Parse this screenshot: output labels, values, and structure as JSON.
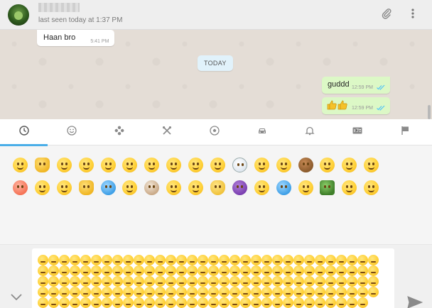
{
  "header": {
    "last_seen": "last seen today at 1:37 PM",
    "icons": [
      "paperclip-icon",
      "more-vertical-icon"
    ]
  },
  "messages": [
    {
      "direction": "incoming",
      "text": "Haan bro",
      "time": "5:41 PM"
    },
    {
      "type": "date-divider",
      "text": "TODAY"
    },
    {
      "direction": "outgoing",
      "text": "guddd",
      "time": "12:59 PM",
      "status": "read"
    },
    {
      "direction": "outgoing",
      "text": "👍👍",
      "time": "12:59 PM",
      "status": "read"
    }
  ],
  "emoji_tabs": [
    {
      "name": "recent",
      "icon": "clock-icon",
      "active": true
    },
    {
      "name": "smileys",
      "icon": "smiley-icon"
    },
    {
      "name": "nature",
      "icon": "flower-icon"
    },
    {
      "name": "food",
      "icon": "fork-knife-icon"
    },
    {
      "name": "activity",
      "icon": "soccer-ball-icon"
    },
    {
      "name": "travel",
      "icon": "car-icon"
    },
    {
      "name": "objects",
      "icon": "bell-icon"
    },
    {
      "name": "symbols",
      "icon": "symbols-icon"
    },
    {
      "name": "flags",
      "icon": "flag-icon"
    }
  ],
  "emoji_grid": {
    "row1": [
      "joy",
      "thumbs-up",
      "smirk",
      "grin",
      "blush",
      "grinning",
      "sweat",
      "unamused",
      "cry",
      "grimacing",
      "snowman",
      "heart-eyes",
      "smile",
      "see-no-evil-monkey",
      "disappointed-relieved",
      "flushed",
      "sweat-smile"
    ],
    "row2": [
      "no-bell",
      "sleeping",
      "stuck-out-tongue",
      "raised-hand",
      "scream",
      "triumph",
      "dog",
      "confounded",
      "mask",
      "cat",
      "imp",
      "relieved",
      "sweat-drops",
      "sleepy",
      "bamboo",
      "dizzy-face",
      "anguished"
    ]
  },
  "composer": {
    "typed_emoji": "unamused",
    "typed_count": 159
  },
  "colors": {
    "header_bg": "#eeeeee",
    "chat_bg": "#e4ddd6",
    "outgoing_bubble": "#dcf8c6",
    "incoming_bubble": "#ffffff",
    "date_chip": "#e1f2fb",
    "active_tab": "#4aaee8",
    "read_ticks": "#4fc3f7"
  }
}
